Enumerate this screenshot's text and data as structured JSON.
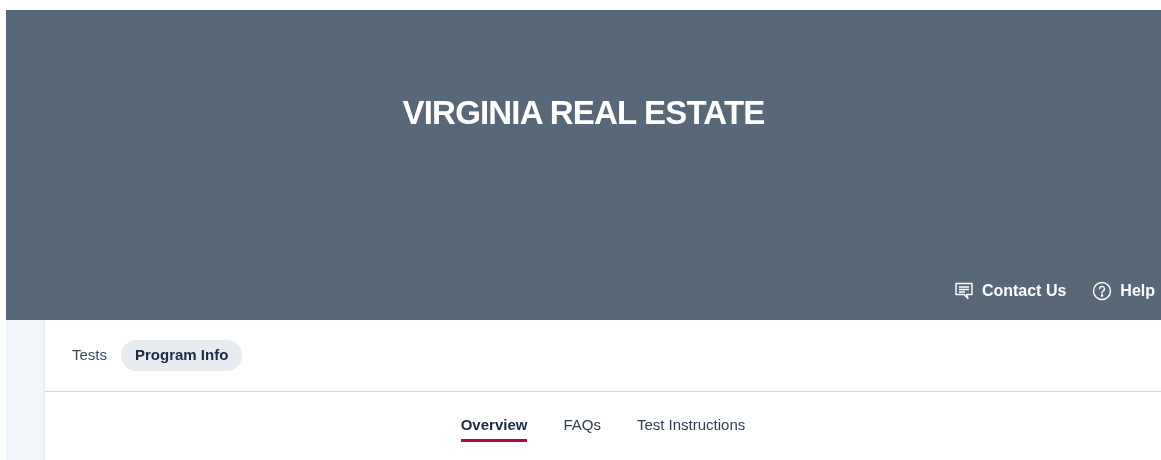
{
  "banner": {
    "title": "VIRGINIA REAL ESTATE",
    "links": [
      {
        "kind": "contact",
        "label": "Contact Us"
      },
      {
        "kind": "help",
        "label": "Help"
      }
    ]
  },
  "nav_tabs": [
    {
      "label": "Tests",
      "selected": false
    },
    {
      "label": "Program Info",
      "selected": true
    }
  ],
  "sub_tabs": [
    {
      "label": "Overview",
      "selected": true
    },
    {
      "label": "FAQs",
      "selected": false
    },
    {
      "label": "Test Instructions",
      "selected": false
    }
  ]
}
